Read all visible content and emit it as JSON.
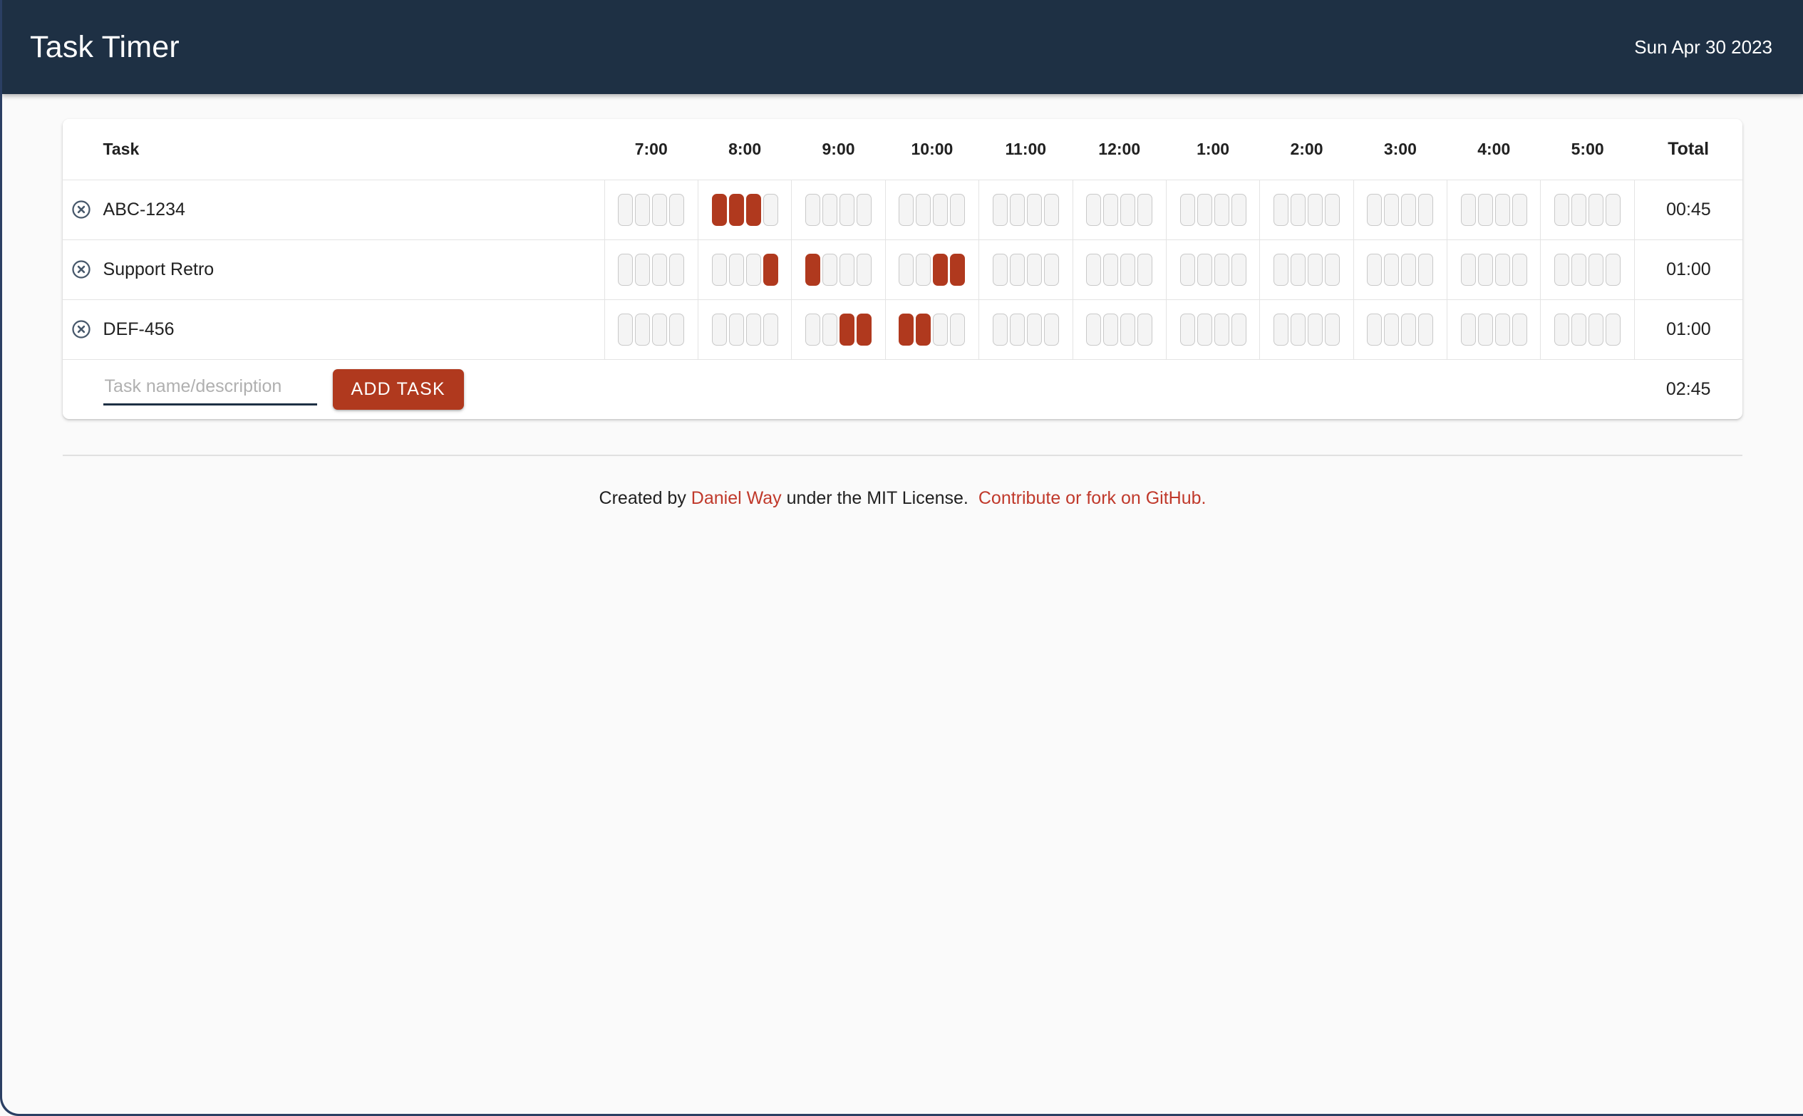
{
  "app": {
    "title": "Task Timer",
    "date": "Sun Apr 30 2023",
    "accent_color": "#b0391e",
    "header_color": "#1e3044"
  },
  "table": {
    "headers": {
      "task": "Task",
      "hours": [
        "7:00",
        "8:00",
        "9:00",
        "10:00",
        "11:00",
        "12:00",
        "1:00",
        "2:00",
        "3:00",
        "4:00",
        "5:00"
      ],
      "total": "Total"
    },
    "rows": [
      {
        "delete_icon": "circle-x-icon",
        "name": "ABC-1234",
        "slots": [
          [
            0,
            0,
            0,
            0
          ],
          [
            1,
            1,
            1,
            0
          ],
          [
            0,
            0,
            0,
            0
          ],
          [
            0,
            0,
            0,
            0
          ],
          [
            0,
            0,
            0,
            0
          ],
          [
            0,
            0,
            0,
            0
          ],
          [
            0,
            0,
            0,
            0
          ],
          [
            0,
            0,
            0,
            0
          ],
          [
            0,
            0,
            0,
            0
          ],
          [
            0,
            0,
            0,
            0
          ],
          [
            0,
            0,
            0,
            0
          ]
        ],
        "total": "00:45"
      },
      {
        "delete_icon": "circle-x-icon",
        "name": "Support Retro",
        "slots": [
          [
            0,
            0,
            0,
            0
          ],
          [
            0,
            0,
            0,
            1
          ],
          [
            1,
            0,
            0,
            0
          ],
          [
            0,
            0,
            1,
            1
          ],
          [
            0,
            0,
            0,
            0
          ],
          [
            0,
            0,
            0,
            0
          ],
          [
            0,
            0,
            0,
            0
          ],
          [
            0,
            0,
            0,
            0
          ],
          [
            0,
            0,
            0,
            0
          ],
          [
            0,
            0,
            0,
            0
          ],
          [
            0,
            0,
            0,
            0
          ]
        ],
        "total": "01:00"
      },
      {
        "delete_icon": "circle-x-icon",
        "name": "DEF-456",
        "slots": [
          [
            0,
            0,
            0,
            0
          ],
          [
            0,
            0,
            0,
            0
          ],
          [
            0,
            0,
            1,
            1
          ],
          [
            1,
            1,
            0,
            0
          ],
          [
            0,
            0,
            0,
            0
          ],
          [
            0,
            0,
            0,
            0
          ],
          [
            0,
            0,
            0,
            0
          ],
          [
            0,
            0,
            0,
            0
          ],
          [
            0,
            0,
            0,
            0
          ],
          [
            0,
            0,
            0,
            0
          ],
          [
            0,
            0,
            0,
            0
          ]
        ],
        "total": "01:00"
      }
    ],
    "add_row": {
      "input_placeholder": "Task name/description",
      "input_value": "",
      "button_label": "ADD TASK",
      "grand_total": "02:45"
    }
  },
  "footer": {
    "created_prefix": "Created by ",
    "author_link": "Daniel Way",
    "license_text": " under the MIT License.",
    "github_link": "Contribute or fork on GitHub."
  }
}
